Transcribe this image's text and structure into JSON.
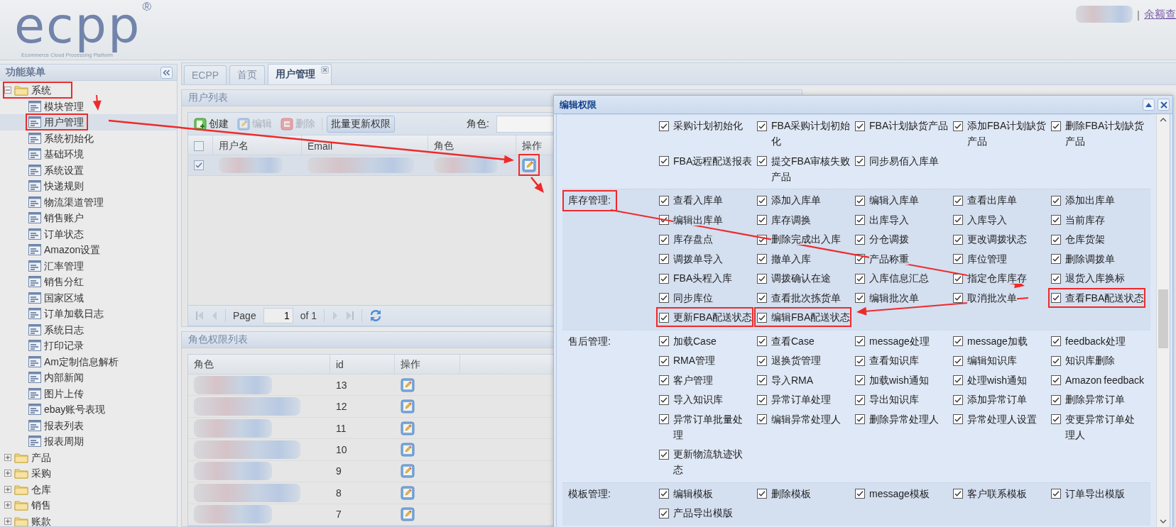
{
  "header": {
    "logo": {
      "text": "ecpp",
      "mark": "®",
      "tagline": "Ecommerce Cloud Processing Platform"
    },
    "separator": "|",
    "link": "余额查"
  },
  "sidebar": {
    "title": "功能菜单",
    "items": [
      {
        "label": "系统",
        "expanded": true,
        "highlighted": true,
        "children": [
          {
            "label": "模块管理",
            "selected": false,
            "highlighted": false
          },
          {
            "label": "用户管理",
            "selected": true,
            "highlighted": true
          },
          {
            "label": "系统初始化",
            "selected": false,
            "highlighted": false
          },
          {
            "label": "基础环境",
            "selected": false,
            "highlighted": false
          },
          {
            "label": "系统设置",
            "selected": false,
            "highlighted": false
          },
          {
            "label": "快递规则",
            "selected": false,
            "highlighted": false
          },
          {
            "label": "物流渠道管理",
            "selected": false,
            "highlighted": false
          },
          {
            "label": "销售账户",
            "selected": false,
            "highlighted": false
          },
          {
            "label": "订单状态",
            "selected": false,
            "highlighted": false
          },
          {
            "label": "Amazon设置",
            "selected": false,
            "highlighted": false
          },
          {
            "label": "汇率管理",
            "selected": false,
            "highlighted": false
          },
          {
            "label": "销售分红",
            "selected": false,
            "highlighted": false
          },
          {
            "label": "国家区域",
            "selected": false,
            "highlighted": false
          },
          {
            "label": "订单加载日志",
            "selected": false,
            "highlighted": false
          },
          {
            "label": "系统日志",
            "selected": false,
            "highlighted": false
          },
          {
            "label": "打印记录",
            "selected": false,
            "highlighted": false
          },
          {
            "label": "Am定制信息解析",
            "selected": false,
            "highlighted": false
          },
          {
            "label": "内部新闻",
            "selected": false,
            "highlighted": false
          },
          {
            "label": "图片上传",
            "selected": false,
            "highlighted": false
          },
          {
            "label": "ebay账号表现",
            "selected": false,
            "highlighted": false
          },
          {
            "label": "报表列表",
            "selected": false,
            "highlighted": false
          },
          {
            "label": "报表周期",
            "selected": false,
            "highlighted": false
          }
        ]
      },
      {
        "label": "产品",
        "expanded": false,
        "highlighted": false
      },
      {
        "label": "采购",
        "expanded": false,
        "highlighted": false
      },
      {
        "label": "仓库",
        "expanded": false,
        "highlighted": false
      },
      {
        "label": "销售",
        "expanded": false,
        "highlighted": false
      },
      {
        "label": "账款",
        "expanded": false,
        "highlighted": false
      }
    ]
  },
  "tabs": [
    {
      "label": "ECPP",
      "selected": false,
      "closable": false
    },
    {
      "label": "首页",
      "selected": false,
      "closable": false
    },
    {
      "label": "用户管理",
      "selected": true,
      "closable": true
    }
  ],
  "user_panel": {
    "title": "用户列表",
    "toolbar": [
      {
        "label": "创建",
        "kind": "create",
        "disabled": false
      },
      {
        "label": "编辑",
        "kind": "edit",
        "disabled": true
      },
      {
        "label": "删除",
        "kind": "delete",
        "disabled": true
      },
      {
        "label": "批量更新权限",
        "kind": "plain",
        "disabled": false
      }
    ],
    "role_filter": {
      "label": "角色:"
    },
    "header_checked": false,
    "columns": [
      "用户名",
      "Email",
      "角色",
      "操作"
    ],
    "rows": [
      {
        "checked": true,
        "action_highlighted": true
      }
    ],
    "pager": {
      "page_label": "Page",
      "page": "1",
      "of": "of 1"
    }
  },
  "role_panel": {
    "title": "角色权限列表",
    "columns": [
      "角色",
      "id",
      "操作"
    ],
    "rows": [
      {
        "id": "13"
      },
      {
        "id": "12"
      },
      {
        "id": "11"
      },
      {
        "id": "10"
      },
      {
        "id": "9"
      },
      {
        "id": "8"
      },
      {
        "id": "7"
      }
    ]
  },
  "dialog": {
    "title": "编辑权限",
    "sections": [
      {
        "items": [
          {
            "label": "采购计划初始化",
            "checked": true,
            "highlighted": false
          },
          {
            "label": "FBA采购计划初始化",
            "checked": true,
            "highlighted": false
          },
          {
            "label": "FBA计划缺货产品",
            "checked": true,
            "highlighted": false
          },
          {
            "label": "添加FBA计划缺货产品",
            "checked": true,
            "highlighted": false
          },
          {
            "label": "删除FBA计划缺货产品",
            "checked": true,
            "highlighted": false
          },
          {
            "label": "FBA远程配送报表",
            "checked": true,
            "highlighted": false
          },
          {
            "label": "提交FBA审核失败产品",
            "checked": true,
            "highlighted": false
          },
          {
            "label": "同步易佰入库单",
            "checked": true,
            "highlighted": false
          }
        ]
      },
      {
        "label": "库存管理:",
        "highlighted": true,
        "items": [
          {
            "label": "查看入库单",
            "checked": true,
            "highlighted": false
          },
          {
            "label": "添加入库单",
            "checked": true,
            "highlighted": false
          },
          {
            "label": "编辑入库单",
            "checked": true,
            "highlighted": false
          },
          {
            "label": "查看出库单",
            "checked": true,
            "highlighted": false
          },
          {
            "label": "添加出库单",
            "checked": true,
            "highlighted": false
          },
          {
            "label": "编辑出库单",
            "checked": true,
            "highlighted": false
          },
          {
            "label": "库存调换",
            "checked": true,
            "highlighted": false
          },
          {
            "label": "出库导入",
            "checked": true,
            "highlighted": false
          },
          {
            "label": "入库导入",
            "checked": true,
            "highlighted": false
          },
          {
            "label": "当前库存",
            "checked": true,
            "highlighted": false
          },
          {
            "label": "库存盘点",
            "checked": true,
            "highlighted": false
          },
          {
            "label": "删除完成出入库",
            "checked": true,
            "highlighted": false
          },
          {
            "label": "分仓调拨",
            "checked": true,
            "highlighted": false
          },
          {
            "label": "更改调拨状态",
            "checked": true,
            "highlighted": false
          },
          {
            "label": "仓库货架",
            "checked": true,
            "highlighted": false
          },
          {
            "label": "调拨单导入",
            "checked": true,
            "highlighted": false
          },
          {
            "label": "撤单入库",
            "checked": true,
            "highlighted": false
          },
          {
            "label": "产品称重",
            "checked": true,
            "highlighted": false
          },
          {
            "label": "库位管理",
            "checked": true,
            "highlighted": false
          },
          {
            "label": "删除调拨单",
            "checked": true,
            "highlighted": false
          },
          {
            "label": "FBA头程入库",
            "checked": true,
            "highlighted": false
          },
          {
            "label": "调拨确认在途",
            "checked": true,
            "highlighted": false
          },
          {
            "label": "入库信息汇总",
            "checked": true,
            "highlighted": false
          },
          {
            "label": "指定仓库库存",
            "checked": true,
            "highlighted": false
          },
          {
            "label": "退货入库换标",
            "checked": true,
            "highlighted": false
          },
          {
            "label": "同步库位",
            "checked": true,
            "highlighted": false
          },
          {
            "label": "查看批次拣货单",
            "checked": true,
            "highlighted": false
          },
          {
            "label": "编辑批次单",
            "checked": true,
            "highlighted": false
          },
          {
            "label": "取消批次单",
            "checked": true,
            "highlighted": false
          },
          {
            "label": "查看FBA配送状态",
            "checked": true,
            "highlighted": true
          },
          {
            "label": "更新FBA配送状态",
            "checked": true,
            "highlighted": true
          },
          {
            "label": "编辑FBA配送状态",
            "checked": true,
            "highlighted": true
          }
        ]
      },
      {
        "label": "售后管理:",
        "highlighted": false,
        "items": [
          {
            "label": "加载Case",
            "checked": true,
            "highlighted": false
          },
          {
            "label": "查看Case",
            "checked": true,
            "highlighted": false
          },
          {
            "label": "message处理",
            "checked": true,
            "highlighted": false
          },
          {
            "label": "message加载",
            "checked": true,
            "highlighted": false
          },
          {
            "label": "feedback处理",
            "checked": true,
            "highlighted": false
          },
          {
            "label": "RMA管理",
            "checked": true,
            "highlighted": false
          },
          {
            "label": "退换货管理",
            "checked": true,
            "highlighted": false
          },
          {
            "label": "查看知识库",
            "checked": true,
            "highlighted": false
          },
          {
            "label": "编辑知识库",
            "checked": true,
            "highlighted": false
          },
          {
            "label": "知识库删除",
            "checked": true,
            "highlighted": false
          },
          {
            "label": "客户管理",
            "checked": true,
            "highlighted": false
          },
          {
            "label": "导入RMA",
            "checked": true,
            "highlighted": false
          },
          {
            "label": "加载wish通知",
            "checked": true,
            "highlighted": false
          },
          {
            "label": "处理wish通知",
            "checked": true,
            "highlighted": false
          },
          {
            "label": "Amazon feedback",
            "checked": true,
            "highlighted": false
          },
          {
            "label": "导入知识库",
            "checked": true,
            "highlighted": false
          },
          {
            "label": "异常订单处理",
            "checked": true,
            "highlighted": false
          },
          {
            "label": "导出知识库",
            "checked": true,
            "highlighted": false
          },
          {
            "label": "添加异常订单",
            "checked": true,
            "highlighted": false
          },
          {
            "label": "删除异常订单",
            "checked": true,
            "highlighted": false
          },
          {
            "label": "异常订单批量处理",
            "checked": true,
            "highlighted": false
          },
          {
            "label": "编辑异常处理人",
            "checked": true,
            "highlighted": false
          },
          {
            "label": "删除异常处理人",
            "checked": true,
            "highlighted": false
          },
          {
            "label": "异常处理人设置",
            "checked": true,
            "highlighted": false
          },
          {
            "label": "变更异常订单处理人",
            "checked": true,
            "highlighted": false
          },
          {
            "label": "更新物流轨迹状态",
            "checked": true,
            "highlighted": false
          }
        ]
      },
      {
        "label": "模板管理:",
        "highlighted": false,
        "items": [
          {
            "label": "编辑模板",
            "checked": true,
            "highlighted": false
          },
          {
            "label": "删除模板",
            "checked": true,
            "highlighted": false
          },
          {
            "label": "message模板",
            "checked": true,
            "highlighted": false
          },
          {
            "label": "客户联系模板",
            "checked": true,
            "highlighted": false
          },
          {
            "label": "订单导出模版",
            "checked": true,
            "highlighted": false
          },
          {
            "label": "产品导出模版",
            "checked": true,
            "highlighted": false
          }
        ]
      }
    ]
  }
}
